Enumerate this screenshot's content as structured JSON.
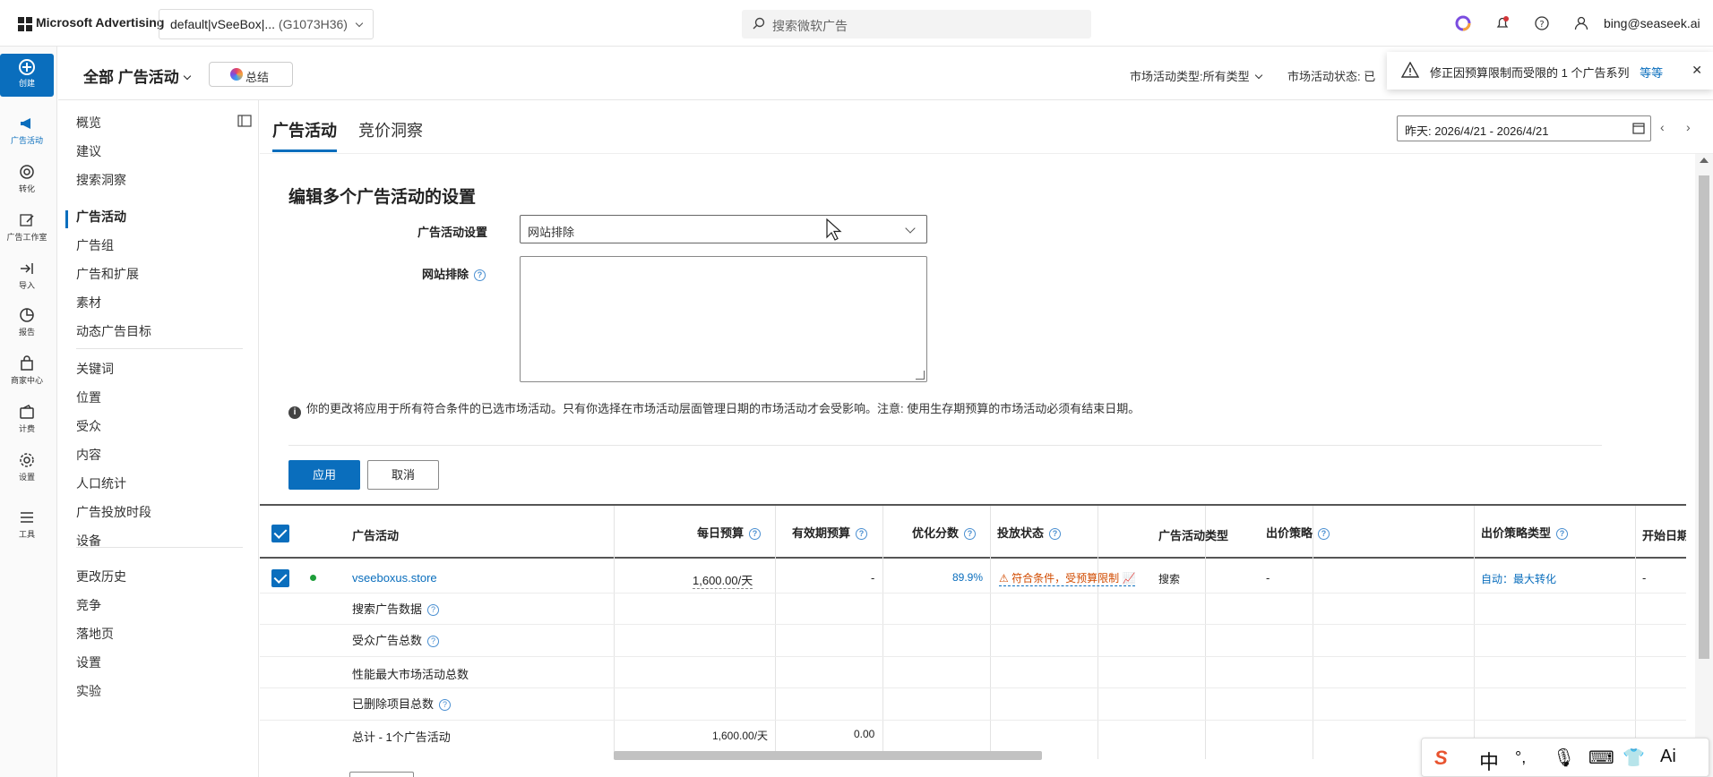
{
  "topbar": {
    "brand": "Microsoft Advertising",
    "account_name": "default|vSeeBox|...",
    "account_id": "(G1073H36)",
    "search_placeholder": "搜索微软广告",
    "user_email": "bing@seaseek.ai"
  },
  "rail": {
    "create": "创建",
    "items": [
      "广告活动",
      "转化",
      "广告工作室",
      "导入",
      "报告",
      "商家中心",
      "计费",
      "设置",
      "工具"
    ]
  },
  "nav": {
    "items": [
      "概览",
      "建议",
      "搜索洞察",
      "广告活动",
      "广告组",
      "广告和扩展",
      "素材",
      "动态广告目标",
      "关键词",
      "位置",
      "受众",
      "内容",
      "人口统计",
      "广告投放时段",
      "设备",
      "更改历史",
      "竞争",
      "落地页",
      "设置",
      "实验"
    ],
    "active": "广告活动"
  },
  "subheader": {
    "scope": "全部 广告活动",
    "summary": "总结",
    "filter_type": "市场活动类型:所有类型",
    "filter_status": "市场活动状态: 已"
  },
  "notification": {
    "text": "修正因预算限制而受限的 1 个广告系列",
    "link": "等等"
  },
  "tabs": [
    "广告活动",
    "竞价洞察"
  ],
  "date_range": "昨天: 2026/4/21 - 2026/4/21",
  "form": {
    "title": "编辑多个广告活动的设置",
    "setting_label": "广告活动设置",
    "setting_value": "网站排除",
    "exclusion_label": "网站排除",
    "exclusion_value": "",
    "info": "你的更改将应用于所有符合条件的已选市场活动。只有你选择在市场活动层面管理日期的市场活动才会受影响。注意: 使用生存期预算的市场活动必须有结束日期。",
    "apply": "应用",
    "cancel": "取消"
  },
  "table": {
    "headers": [
      "广告活动",
      "每日预算",
      "有效期预算",
      "优化分数",
      "投放状态",
      "广告活动类型",
      "出价策略",
      "出价策略类型",
      "开始日期"
    ],
    "row": {
      "campaign": "vseeboxus.store",
      "daily_budget": "1,600.00/天",
      "lifetime_budget": "-",
      "opt_score": "89.9%",
      "delivery": "符合条件，受预算限制",
      "type": "搜索",
      "bid_strategy": "-",
      "bid_strategy_type": "自动：最大转化",
      "start_date": "-"
    },
    "summary_rows": [
      "搜索广告数据",
      "受众广告总数",
      "性能最大市场活动总数",
      "已删除项目总数"
    ],
    "total_label": "总计 - 1个广告活动",
    "total_daily": "1,600.00/天",
    "total_lifetime": "0.00"
  },
  "ime": [
    "中",
    "°,",
    "Ai"
  ],
  "colors": {
    "accent": "#0a6ebd",
    "warning": "#d14b00",
    "active": "#1e9e3a"
  }
}
